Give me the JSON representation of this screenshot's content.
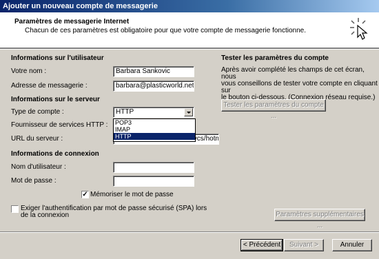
{
  "window": {
    "title": "Ajouter un nouveau compte de messagerie"
  },
  "header": {
    "title": "Paramètres de messagerie Internet",
    "description": "Chacun de ces paramètres est obligatoire pour que votre compte de messagerie fonctionne."
  },
  "user_info": {
    "heading": "Informations sur l'utilisateur",
    "name_label": "Votre nom :",
    "name_value": "Barbara Sankovic",
    "email_label": "Adresse de messagerie :",
    "email_value": "barbara@plasticworld.net"
  },
  "server_info": {
    "heading": "Informations sur le serveur",
    "account_type_label": "Type de compte :",
    "account_type_value": "HTTP",
    "account_type_options": [
      "POP3",
      "IMAP",
      "HTTP"
    ],
    "provider_label": "Fournisseur de services HTTP :",
    "url_label": "URL du serveur :",
    "url_value": "http://services.msn.com/svcs/hotmail/h"
  },
  "login_info": {
    "heading": "Informations de connexion",
    "username_label": "Nom d'utilisateur :",
    "username_value": "",
    "password_label": "Mot de passe :",
    "password_value": "",
    "remember_password_label": "Mémoriser le mot de passe",
    "remember_password_checked": true,
    "spa_label_line1": "Exiger l'authentification par mot de passe sécurisé (SPA) lors",
    "spa_label_line2": "de la connexion",
    "spa_checked": false
  },
  "test_settings": {
    "heading": "Tester les paramètres du compte",
    "desc_line1": "Après avoir complété les champs de cet écran, nous",
    "desc_line2": "vous conseillons de tester votre compte en cliquant sur",
    "desc_line3": "le bouton ci-dessous. (Connexion réseau requise.)",
    "test_button": "Tester les paramètres du compte ..."
  },
  "buttons": {
    "more_settings": "Paramètres supplémentaires ...",
    "back": "< Précédent",
    "next": "Suivant >",
    "cancel": "Annuler"
  }
}
